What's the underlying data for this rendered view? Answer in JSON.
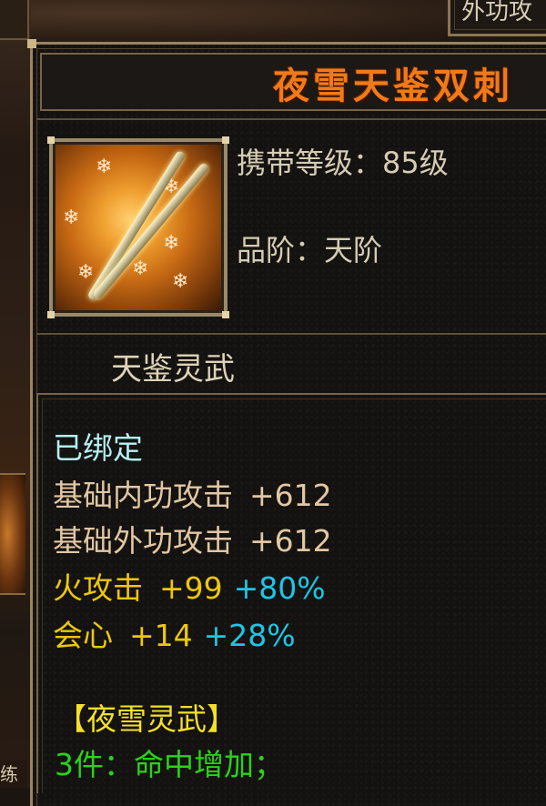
{
  "top_tab": {
    "label": "外功攻"
  },
  "background": {
    "bottom_char": "练"
  },
  "item": {
    "name": "夜雪天鉴双刺",
    "carry_level_label": "携带等级：",
    "carry_level_value": "85级",
    "grade_label": "品阶：",
    "grade_value": "天阶",
    "category": "天鉴灵武",
    "icon": "twin-daggers-icon"
  },
  "attributes": {
    "bound": "已绑定",
    "base_inner_attack": {
      "label": "基础内功攻击",
      "value": "+612"
    },
    "base_outer_attack": {
      "label": "基础外功攻击",
      "value": "+612"
    },
    "fire_attack": {
      "label": "火攻击",
      "value": "+99",
      "bonus": "+80%"
    },
    "crit": {
      "label": "会心",
      "value": "+14",
      "bonus": "+28%"
    }
  },
  "set": {
    "name": "【夜雪灵武】",
    "bonus_3": "3件：命中增加；"
  },
  "colors": {
    "title": "#f07a1a",
    "bound": "#b4f0f4",
    "base_stat": "#e2c7a2",
    "extra_stat": "#ecc70c",
    "bonus_pct": "#1cc7e6",
    "set_name": "#f4e028",
    "set_bonus": "#2ad21a"
  }
}
